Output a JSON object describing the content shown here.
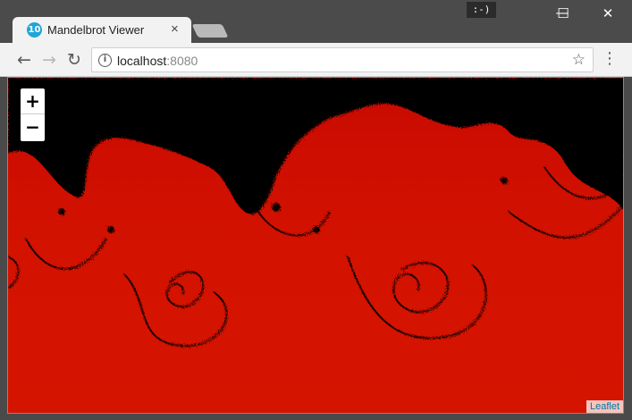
{
  "browser": {
    "tab_title": "Mandelbrot Viewer",
    "tab_favicon_text": "10",
    "tab_close": "×",
    "badge_text": ":-)",
    "minimize": "—",
    "maximize": "☐",
    "close": "✕",
    "back": "←",
    "forward": "→",
    "reload": "↻",
    "url_host": "localhost",
    "url_port": ":8080",
    "info_glyph": "i",
    "star": "☆",
    "menu": "⋮"
  },
  "map": {
    "zoom_in": "+",
    "zoom_out": "−",
    "attribution": "Leaflet"
  },
  "colors": {
    "fractal_red": "#d31200",
    "fractal_black": "#000000",
    "leaflet_link": "#0078a8"
  }
}
